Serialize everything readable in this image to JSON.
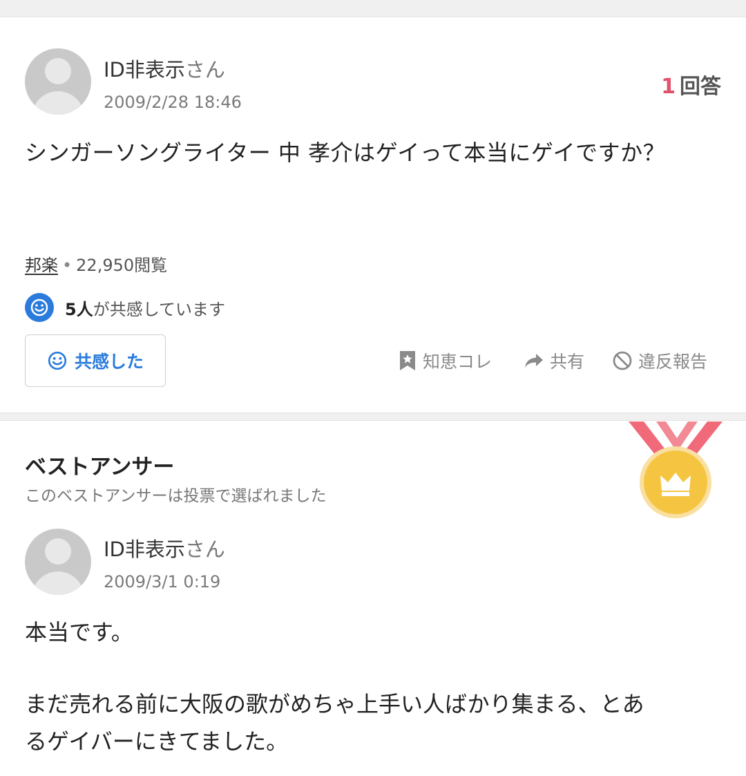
{
  "question": {
    "user_name": "ID非表示",
    "user_suffix": "さん",
    "date": "2009/2/28 18:46",
    "answer_count": "1",
    "answer_label": "回答",
    "text": "シンガーソングライター 中 孝介はゲイって本当にゲイですか？",
    "category": "邦楽",
    "views": "22,950閲覧",
    "empathy_count": "5人",
    "empathy_suffix": "が共感しています",
    "empathy_button": "共感した",
    "actions": {
      "bookmark": "知恵コレ",
      "share": "共有",
      "report": "違反報告"
    }
  },
  "best_answer": {
    "title": "ベストアンサー",
    "subtitle": "このベストアンサーは投票で選ばれました",
    "user_name": "ID非表示",
    "user_suffix": "さん",
    "date": "2009/3/1 0:19",
    "lines": [
      "本当です。",
      "まだ売れる前に大阪の歌がめちゃ上手い人ばかり集まる、とあ",
      "るゲイバーにきてました。"
    ]
  },
  "colors": {
    "accent_blue": "#2a7bdc",
    "answer_count_red": "#e0516b",
    "medal_gold": "#f5c542"
  }
}
